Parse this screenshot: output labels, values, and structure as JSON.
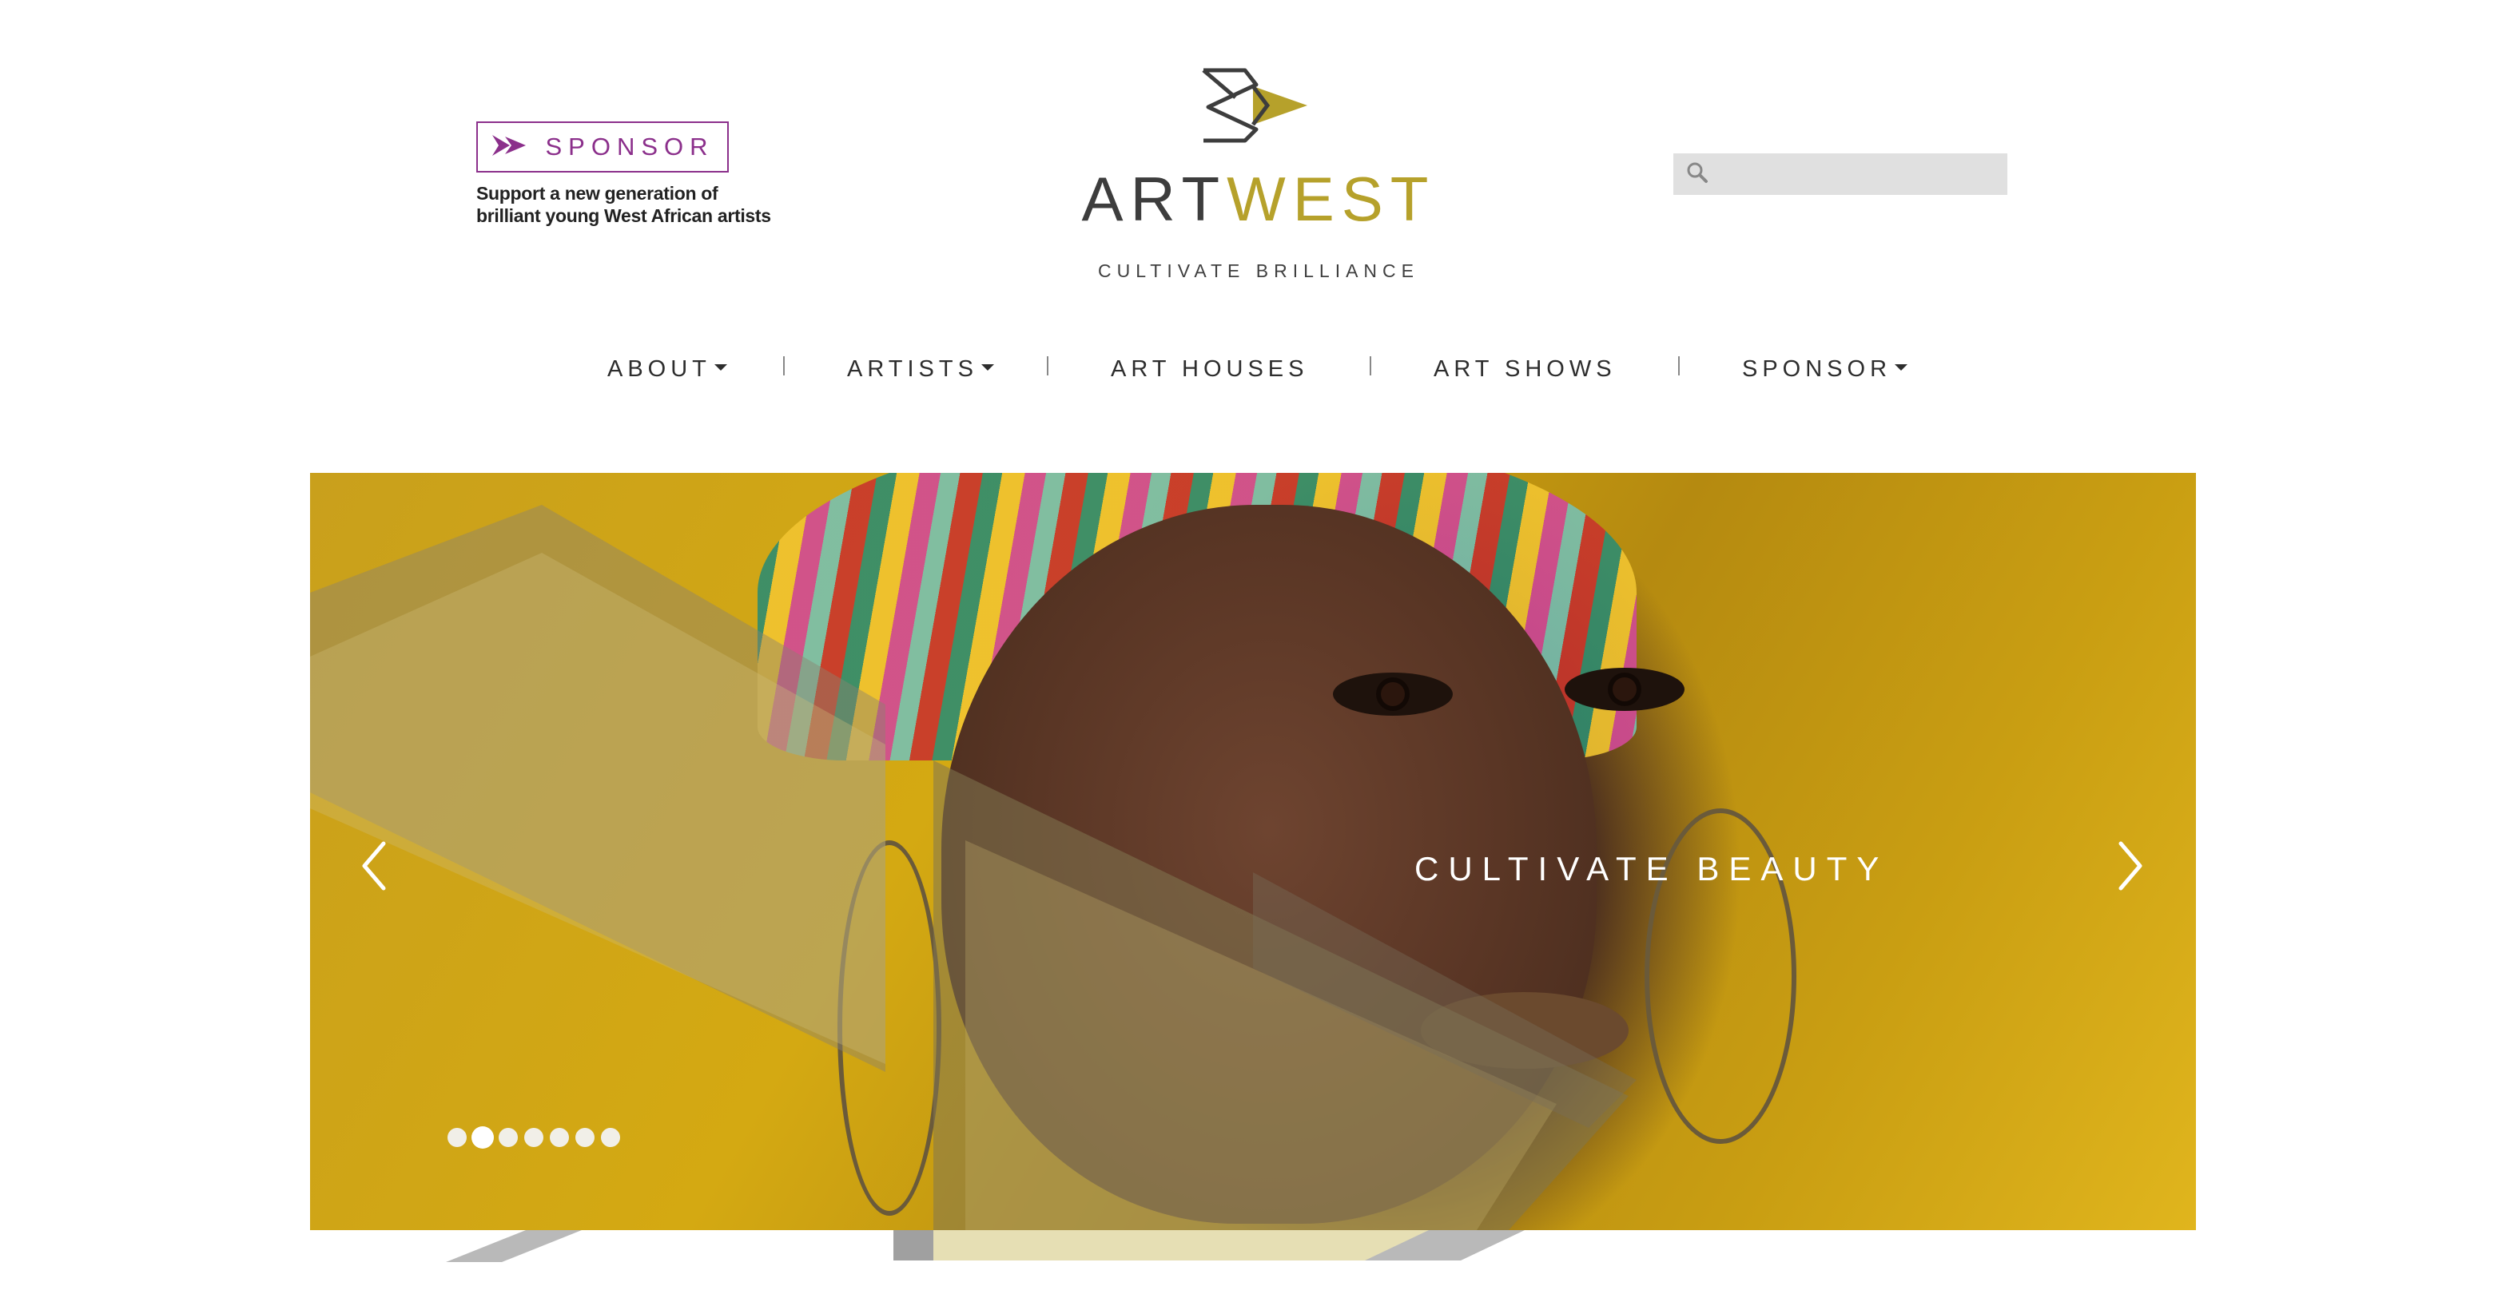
{
  "sponsor": {
    "label": "SPONSOR",
    "tagline_line1": "Support a new generation of",
    "tagline_line2": "brilliant young West African artists",
    "color": "#8b2f8b"
  },
  "brand": {
    "name_part1": "ART",
    "name_part2": "WEST",
    "tagline": "CULTIVATE BRILLIANCE",
    "accent_color": "#b6a12b",
    "dark_color": "#3d3d3d"
  },
  "search": {
    "placeholder": "",
    "icon": "search-icon"
  },
  "nav": {
    "items": [
      {
        "label": "ABOUT",
        "has_dropdown": true
      },
      {
        "label": "ARTISTS",
        "has_dropdown": true
      },
      {
        "label": "ART HOUSES",
        "has_dropdown": false
      },
      {
        "label": "ART SHOWS",
        "has_dropdown": false
      },
      {
        "label": "SPONSOR",
        "has_dropdown": true
      }
    ]
  },
  "hero": {
    "caption": "CULTIVATE BEAUTY",
    "prev_icon": "chevron-left-icon",
    "next_icon": "chevron-right-icon",
    "slide_count": 7,
    "active_slide": 2
  }
}
